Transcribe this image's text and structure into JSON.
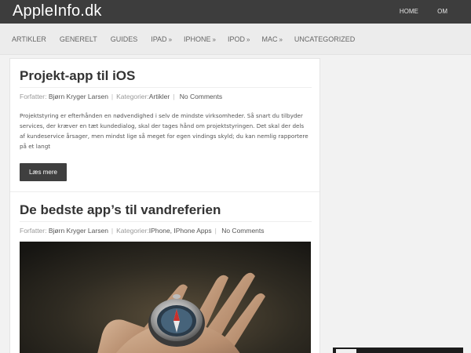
{
  "header": {
    "logo": "AppleInfo.dk",
    "nav": [
      {
        "label": "HOME"
      },
      {
        "label": "OM"
      }
    ]
  },
  "menu": [
    {
      "label": "ARTIKLER",
      "arrow": ""
    },
    {
      "label": "GENERELT",
      "arrow": ""
    },
    {
      "label": "GUIDES",
      "arrow": ""
    },
    {
      "label": "IPAD",
      "arrow": "»"
    },
    {
      "label": "IPHONE",
      "arrow": "»"
    },
    {
      "label": "IPOD",
      "arrow": "»"
    },
    {
      "label": "MAC",
      "arrow": "»"
    },
    {
      "label": "UNCATEGORIZED",
      "arrow": ""
    }
  ],
  "posts": [
    {
      "title": "Projekt-app til iOS",
      "author_label": "Forfatter:",
      "author": "Bjørn Kryger Larsen",
      "category_label": "Kategorier:",
      "categories": "Artikler",
      "comments": "No Comments",
      "excerpt": "Projektstyring er efterhånden en nødvendighed i selv de mindste virksomheder. Så snart du tilbyder services, der kræver en tæt kundedialog, skal der tages hånd om projektstyringen. Det skal der dels af kundeservice årsager, men mindst lige så meget for egen vindings skyld; du kan nemlig rapportere på et langt",
      "read_more": "Læs mere"
    },
    {
      "title": "De bedste app’s til vandreferien",
      "author_label": "Forfatter:",
      "author": "Bjørn Kryger Larsen",
      "category_label": "Kategorier:",
      "categories": "IPhone, IPhone Apps",
      "comments": "No Comments"
    }
  ],
  "colors": {
    "topbar": "#3d3d3d",
    "button": "#3f3f3f",
    "background": "#f2f2f2"
  }
}
